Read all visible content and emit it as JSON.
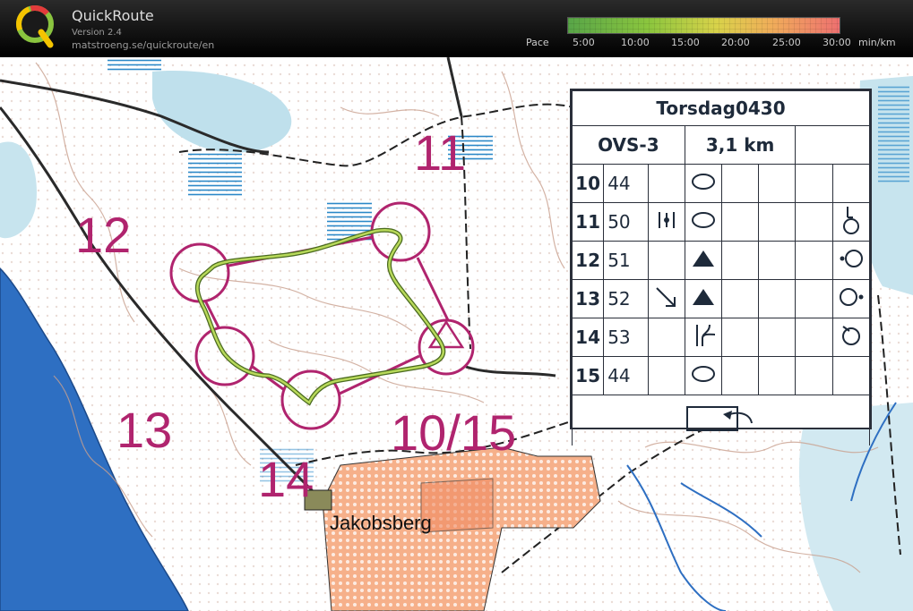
{
  "header": {
    "app_name": "QuickRoute",
    "version": "Version 2.4",
    "url": "matstroeng.se/quickroute/en"
  },
  "pace_scale": {
    "label": "Pace",
    "ticks": [
      "5:00",
      "10:00",
      "15:00",
      "20:00",
      "25:00",
      "30:00"
    ],
    "unit": "min/km",
    "colors": [
      "#58a548",
      "#8cc63e",
      "#d9d24a",
      "#f0ad5a",
      "#ee7070"
    ]
  },
  "map": {
    "control_numbers": [
      "11",
      "12",
      "13",
      "14",
      "10/15"
    ],
    "place_name": "Jakobsberg",
    "colors": {
      "course": "#b0246e",
      "route": "#b8d95a",
      "water": "#2e6fc2",
      "marsh": "#2b88c8",
      "urban": "#f08b62"
    }
  },
  "description_sheet": {
    "event": "Torsdag0430",
    "course": "OVS-3",
    "length": "3,1 km",
    "rows": [
      {
        "num": "10",
        "code": "44",
        "feature_icon": "knoll-icon",
        "dir_icon": "",
        "extra_icon": "",
        "loc_icon": ""
      },
      {
        "num": "11",
        "code": "50",
        "feature_icon": "knoll-icon",
        "dir_icon": "",
        "extra_icon": "vegetation-icon",
        "loc_icon": "foot-icon"
      },
      {
        "num": "12",
        "code": "51",
        "feature_icon": "boulder-icon",
        "dir_icon": "",
        "extra_icon": "",
        "loc_icon": "west-side-icon"
      },
      {
        "num": "13",
        "code": "52",
        "feature_icon": "boulder-icon",
        "dir_icon": "",
        "extra_icon": "southeast-arrow-icon",
        "loc_icon": "east-side-icon"
      },
      {
        "num": "14",
        "code": "53",
        "feature_icon": "re-entrant-icon",
        "dir_icon": "",
        "extra_icon": "",
        "loc_icon": "north-east-corner-icon"
      },
      {
        "num": "15",
        "code": "44",
        "feature_icon": "knoll-icon",
        "dir_icon": "",
        "extra_icon": "",
        "loc_icon": ""
      }
    ],
    "finish_icon": "finish-tape-icon"
  }
}
